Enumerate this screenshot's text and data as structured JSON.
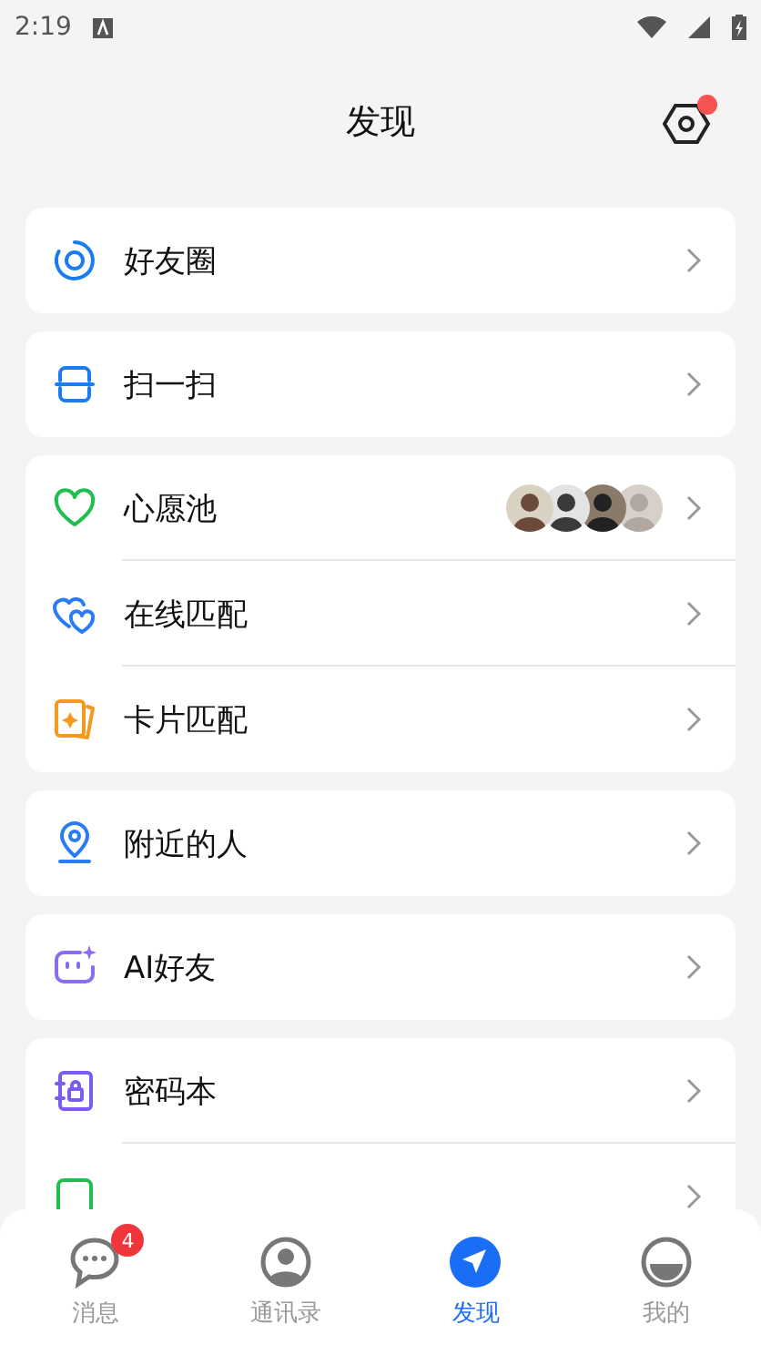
{
  "status_bar": {
    "time": "2:19"
  },
  "header": {
    "title": "发现",
    "settings_badge": true
  },
  "groups": [
    {
      "items": [
        {
          "label": "好友圈"
        }
      ]
    },
    {
      "items": [
        {
          "label": "扫一扫"
        }
      ]
    },
    {
      "items": [
        {
          "label": "心愿池"
        },
        {
          "label": "在线匹配"
        },
        {
          "label": "卡片匹配"
        }
      ]
    },
    {
      "items": [
        {
          "label": "附近的人"
        }
      ]
    },
    {
      "items": [
        {
          "label": "AI好友"
        }
      ]
    },
    {
      "items": [
        {
          "kind": "row",
          "label": "密码本"
        },
        {
          "kind": "clipped"
        }
      ]
    }
  ],
  "tabs": [
    {
      "label": "消息",
      "selected": false,
      "badge": "4"
    },
    {
      "label": "通讯录",
      "selected": false
    },
    {
      "label": "发现",
      "selected": true
    },
    {
      "label": "我的",
      "selected": false
    }
  ]
}
